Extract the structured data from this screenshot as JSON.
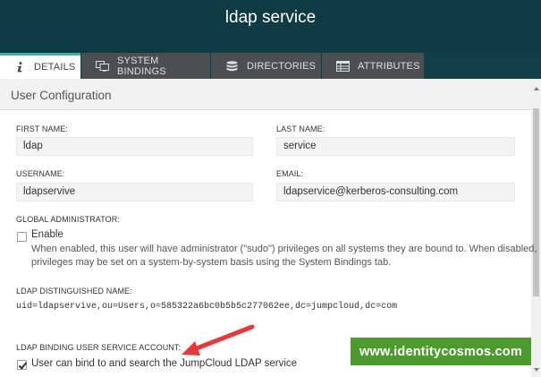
{
  "header": {
    "title": "ldap service"
  },
  "tabs": [
    {
      "label": "DETAILS",
      "icon": "info-icon",
      "active": true
    },
    {
      "label": "SYSTEM BINDINGS",
      "icon": "monitor-icon",
      "active": false
    },
    {
      "label": "DIRECTORIES",
      "icon": "database-icon",
      "active": false
    },
    {
      "label": "ATTRIBUTES",
      "icon": "table-icon",
      "active": false
    }
  ],
  "section": {
    "title": "User Configuration"
  },
  "form": {
    "first_name": {
      "label": "FIRST NAME:",
      "value": "ldap"
    },
    "last_name": {
      "label": "LAST NAME:",
      "value": "service"
    },
    "username": {
      "label": "USERNAME:",
      "value": "ldapservive"
    },
    "email": {
      "label": "EMAIL:",
      "value": "ldapservice@kerberos-consulting.com"
    },
    "global_admin": {
      "label": "GLOBAL ADMINISTRATOR:",
      "option": "Enable",
      "checked": false,
      "description_line1": "When enabled, this user will have administrator (\"sudo\") privileges on all systems they are bound to. When disabled,",
      "description_line2": "privileges may be set on a system-by-system basis using the System Bindings tab."
    },
    "ldap_dn": {
      "label": "LDAP DISTINGUISHED NAME:",
      "value": "uid=ldapservive,ou=Users,o=585322a6bc0b5b5c277062ee,dc=jumpcloud,dc=com"
    },
    "ldap_binding": {
      "label": "LDAP BINDING USER SERVICE ACCOUNT:",
      "option": "User can bind to and search the JumpCloud LDAP service",
      "checked": true
    }
  },
  "watermark": {
    "text": "www.identitycosmos.com",
    "color": "#4f9a2e"
  },
  "annotation": {
    "arrow_color": "#e63a3a"
  },
  "colors": {
    "header_bg": "#0e3b44",
    "tab_inactive": "#4b4f52",
    "tab_accent": "#3cb3a3"
  }
}
